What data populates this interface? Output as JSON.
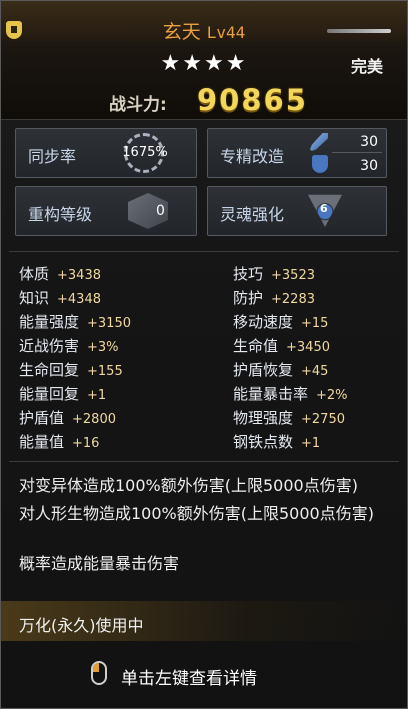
{
  "item": {
    "name": "玄天",
    "level": "Lv44",
    "stars": "★★★★",
    "quality": "完美",
    "power_label": "战斗力:",
    "power_value": "90865"
  },
  "stat_boxes": {
    "sync": {
      "label": "同步率",
      "value": "1675%"
    },
    "enhance": {
      "label": "专精改造",
      "top": "30",
      "bottom": "30"
    },
    "rebuild": {
      "label": "重构等级",
      "value": "0"
    },
    "soul": {
      "label": "灵魂强化",
      "value": "6"
    }
  },
  "attributes": [
    {
      "name": "体质",
      "value": "+3438"
    },
    {
      "name": "技巧",
      "value": "+3523"
    },
    {
      "name": "知识",
      "value": "+4348"
    },
    {
      "name": "防护",
      "value": "+2283"
    },
    {
      "name": "能量强度",
      "value": "+3150"
    },
    {
      "name": "移动速度",
      "value": "+15"
    },
    {
      "name": "近战伤害",
      "value": "+3%"
    },
    {
      "name": "生命值",
      "value": "+3450"
    },
    {
      "name": "生命回复",
      "value": "+155"
    },
    {
      "name": "护盾恢复",
      "value": "+45"
    },
    {
      "name": "能量回复",
      "value": "+1"
    },
    {
      "name": "能量暴击率",
      "value": "+2%"
    },
    {
      "name": "护盾值",
      "value": "+2800"
    },
    {
      "name": "物理强度",
      "value": "+2750"
    },
    {
      "name": "能量值",
      "value": "+16"
    },
    {
      "name": "钢铁点数",
      "value": "+1"
    }
  ],
  "effects": [
    "对变异体造成100%额外伤害(上限5000点伤害)",
    "对人形生物造成100%额外伤害(上限5000点伤害)",
    "概率造成能量暴击伤害"
  ],
  "status": "万化(永久)使用中",
  "hint": "单击左键查看详情",
  "colors": {
    "name": "#e8a040",
    "power": "#f2d75a",
    "attr_value": "#f0d8a0"
  }
}
